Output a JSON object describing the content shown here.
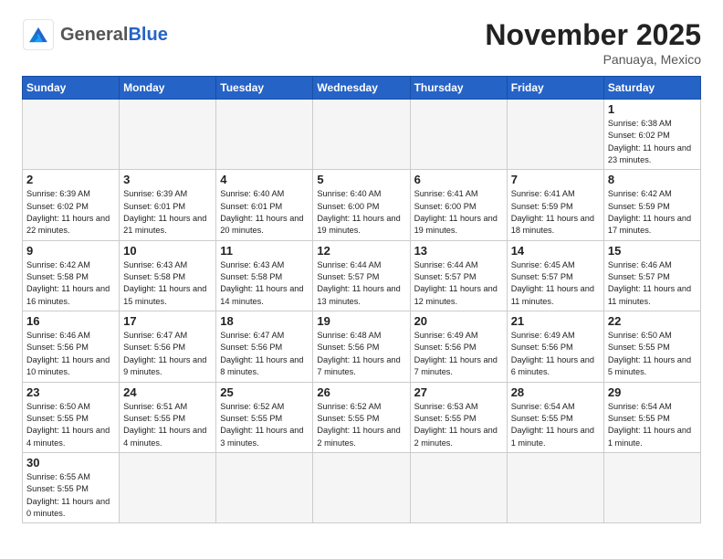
{
  "header": {
    "logo_general": "General",
    "logo_blue": "Blue",
    "month": "November 2025",
    "location": "Panuaya, Mexico"
  },
  "weekdays": [
    "Sunday",
    "Monday",
    "Tuesday",
    "Wednesday",
    "Thursday",
    "Friday",
    "Saturday"
  ],
  "weeks": [
    [
      {
        "day": "",
        "empty": true
      },
      {
        "day": "",
        "empty": true
      },
      {
        "day": "",
        "empty": true
      },
      {
        "day": "",
        "empty": true
      },
      {
        "day": "",
        "empty": true
      },
      {
        "day": "",
        "empty": true
      },
      {
        "day": "1",
        "sunrise": "6:38 AM",
        "sunset": "6:02 PM",
        "daylight": "11 hours and 23 minutes."
      }
    ],
    [
      {
        "day": "2",
        "sunrise": "6:39 AM",
        "sunset": "6:02 PM",
        "daylight": "11 hours and 22 minutes."
      },
      {
        "day": "3",
        "sunrise": "6:39 AM",
        "sunset": "6:01 PM",
        "daylight": "11 hours and 21 minutes."
      },
      {
        "day": "4",
        "sunrise": "6:40 AM",
        "sunset": "6:01 PM",
        "daylight": "11 hours and 20 minutes."
      },
      {
        "day": "5",
        "sunrise": "6:40 AM",
        "sunset": "6:00 PM",
        "daylight": "11 hours and 19 minutes."
      },
      {
        "day": "6",
        "sunrise": "6:41 AM",
        "sunset": "6:00 PM",
        "daylight": "11 hours and 19 minutes."
      },
      {
        "day": "7",
        "sunrise": "6:41 AM",
        "sunset": "5:59 PM",
        "daylight": "11 hours and 18 minutes."
      },
      {
        "day": "8",
        "sunrise": "6:42 AM",
        "sunset": "5:59 PM",
        "daylight": "11 hours and 17 minutes."
      }
    ],
    [
      {
        "day": "9",
        "sunrise": "6:42 AM",
        "sunset": "5:58 PM",
        "daylight": "11 hours and 16 minutes."
      },
      {
        "day": "10",
        "sunrise": "6:43 AM",
        "sunset": "5:58 PM",
        "daylight": "11 hours and 15 minutes."
      },
      {
        "day": "11",
        "sunrise": "6:43 AM",
        "sunset": "5:58 PM",
        "daylight": "11 hours and 14 minutes."
      },
      {
        "day": "12",
        "sunrise": "6:44 AM",
        "sunset": "5:57 PM",
        "daylight": "11 hours and 13 minutes."
      },
      {
        "day": "13",
        "sunrise": "6:44 AM",
        "sunset": "5:57 PM",
        "daylight": "11 hours and 12 minutes."
      },
      {
        "day": "14",
        "sunrise": "6:45 AM",
        "sunset": "5:57 PM",
        "daylight": "11 hours and 11 minutes."
      },
      {
        "day": "15",
        "sunrise": "6:46 AM",
        "sunset": "5:57 PM",
        "daylight": "11 hours and 11 minutes."
      }
    ],
    [
      {
        "day": "16",
        "sunrise": "6:46 AM",
        "sunset": "5:56 PM",
        "daylight": "11 hours and 10 minutes."
      },
      {
        "day": "17",
        "sunrise": "6:47 AM",
        "sunset": "5:56 PM",
        "daylight": "11 hours and 9 minutes."
      },
      {
        "day": "18",
        "sunrise": "6:47 AM",
        "sunset": "5:56 PM",
        "daylight": "11 hours and 8 minutes."
      },
      {
        "day": "19",
        "sunrise": "6:48 AM",
        "sunset": "5:56 PM",
        "daylight": "11 hours and 7 minutes."
      },
      {
        "day": "20",
        "sunrise": "6:49 AM",
        "sunset": "5:56 PM",
        "daylight": "11 hours and 7 minutes."
      },
      {
        "day": "21",
        "sunrise": "6:49 AM",
        "sunset": "5:56 PM",
        "daylight": "11 hours and 6 minutes."
      },
      {
        "day": "22",
        "sunrise": "6:50 AM",
        "sunset": "5:55 PM",
        "daylight": "11 hours and 5 minutes."
      }
    ],
    [
      {
        "day": "23",
        "sunrise": "6:50 AM",
        "sunset": "5:55 PM",
        "daylight": "11 hours and 4 minutes."
      },
      {
        "day": "24",
        "sunrise": "6:51 AM",
        "sunset": "5:55 PM",
        "daylight": "11 hours and 4 minutes."
      },
      {
        "day": "25",
        "sunrise": "6:52 AM",
        "sunset": "5:55 PM",
        "daylight": "11 hours and 3 minutes."
      },
      {
        "day": "26",
        "sunrise": "6:52 AM",
        "sunset": "5:55 PM",
        "daylight": "11 hours and 2 minutes."
      },
      {
        "day": "27",
        "sunrise": "6:53 AM",
        "sunset": "5:55 PM",
        "daylight": "11 hours and 2 minutes."
      },
      {
        "day": "28",
        "sunrise": "6:54 AM",
        "sunset": "5:55 PM",
        "daylight": "11 hours and 1 minute."
      },
      {
        "day": "29",
        "sunrise": "6:54 AM",
        "sunset": "5:55 PM",
        "daylight": "11 hours and 1 minute."
      }
    ],
    [
      {
        "day": "30",
        "sunrise": "6:55 AM",
        "sunset": "5:55 PM",
        "daylight": "11 hours and 0 minutes."
      },
      {
        "day": "",
        "empty": true
      },
      {
        "day": "",
        "empty": true
      },
      {
        "day": "",
        "empty": true
      },
      {
        "day": "",
        "empty": true
      },
      {
        "day": "",
        "empty": true
      },
      {
        "day": "",
        "empty": true
      }
    ]
  ],
  "labels": {
    "sunrise": "Sunrise:",
    "sunset": "Sunset:",
    "daylight": "Daylight:"
  }
}
